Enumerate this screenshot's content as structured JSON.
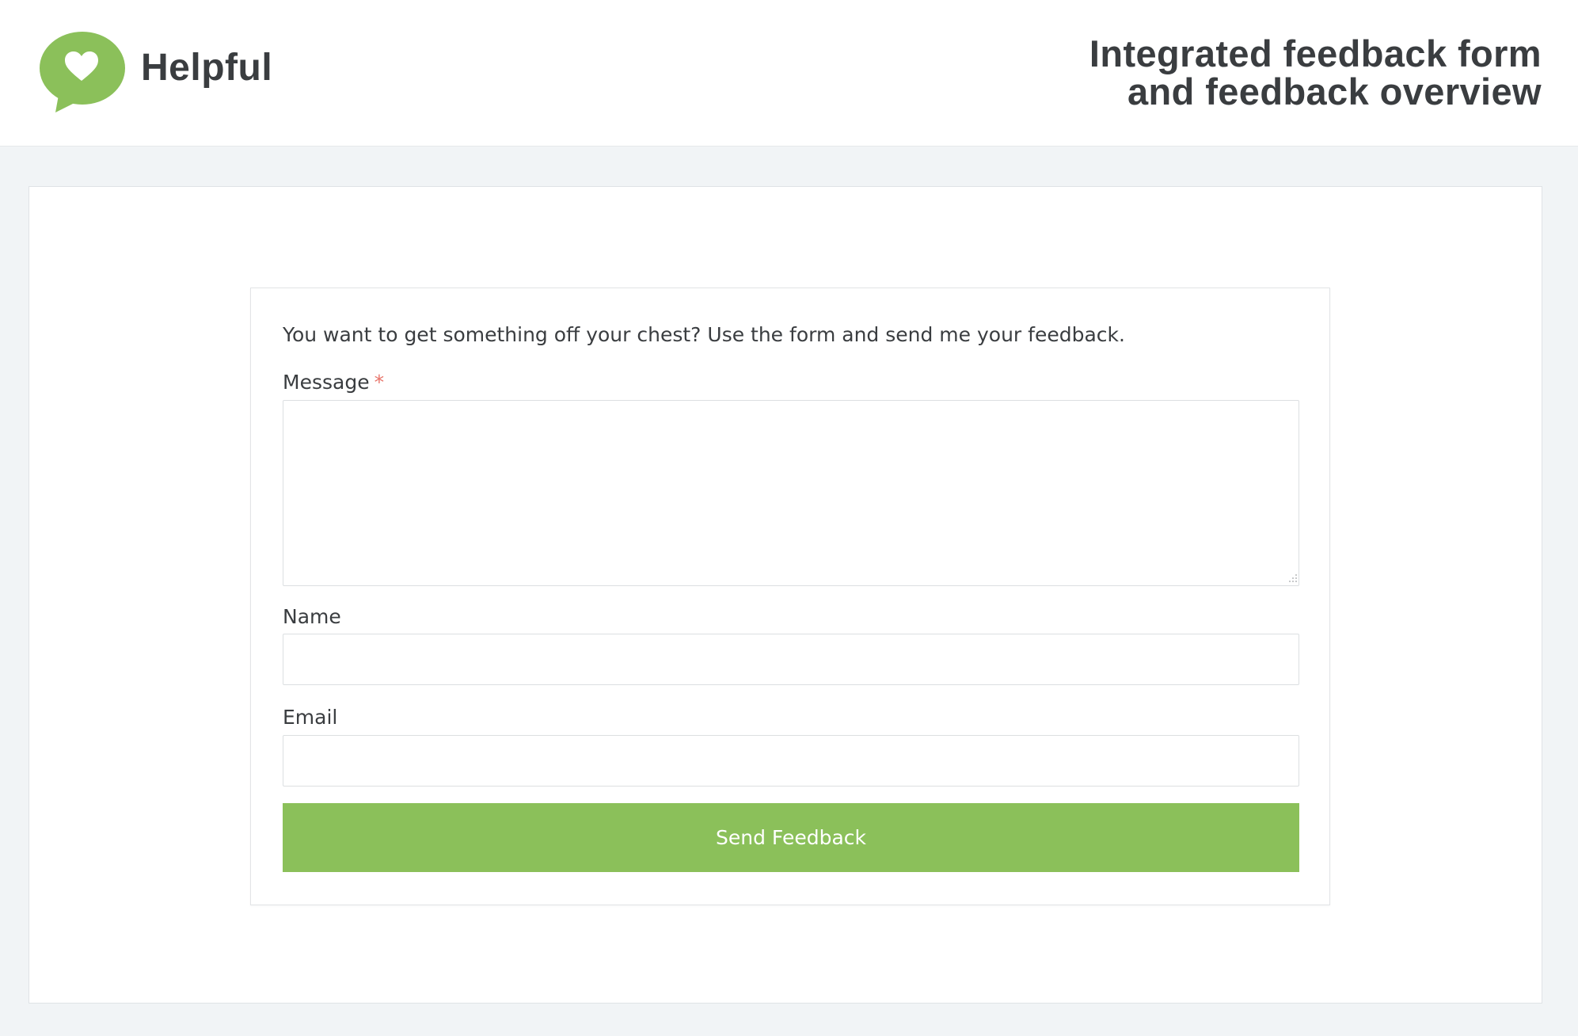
{
  "header": {
    "brand_name": "Helpful",
    "tagline_line1": "Integrated feedback form",
    "tagline_line2": "and feedback overview",
    "logo_icon": "heart-speech-bubble-icon",
    "brand_color": "#8bc05a"
  },
  "form": {
    "intro": "You want to get something off your chest? Use the form and send me your feedback.",
    "message_label": "Message",
    "required_marker": "*",
    "message_value": "",
    "name_label": "Name",
    "name_value": "",
    "email_label": "Email",
    "email_value": "",
    "submit_label": "Send Feedback",
    "submit_color": "#8bc05a",
    "required_color": "#e8756b"
  }
}
